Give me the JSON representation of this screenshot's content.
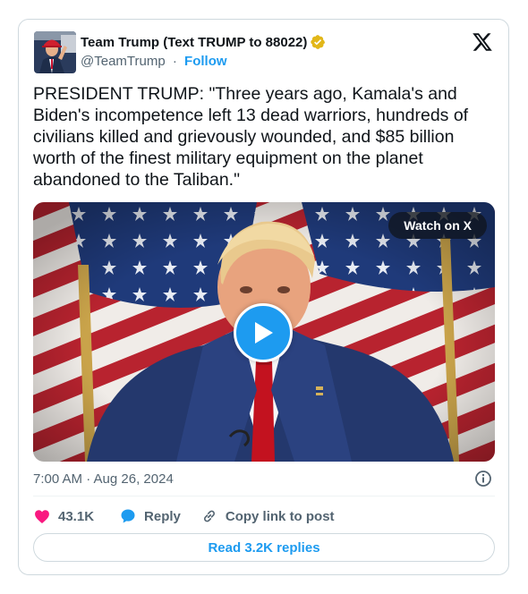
{
  "author": {
    "name": "Team Trump (Text TRUMP to 88022)",
    "handle": "@TeamTrump",
    "separator": "·",
    "follow_label": "Follow",
    "verified_color": "#e2b719"
  },
  "tweet": {
    "text": "PRESIDENT TRUMP: \"Three years ago, Kamala's and Biden's incompetence left 13 dead warriors, hundreds of civilians killed and grievously wounded, and $85 billion worth of the finest military equipment on the planet abandoned to the Taliban.\"",
    "timestamp": "7:00 AM · Aug 26, 2024"
  },
  "media": {
    "watch_label": "Watch on X",
    "play_icon": "play-icon"
  },
  "actions": {
    "likes": "43.1K",
    "reply_label": "Reply",
    "copy_link_label": "Copy link to post",
    "read_replies_label": "Read 3.2K replies"
  },
  "colors": {
    "accent": "#1d9bf0",
    "like": "#f91880",
    "muted": "#536471",
    "border": "#cfd9de"
  },
  "icons": [
    "x-logo-icon",
    "verified-badge-icon",
    "info-icon",
    "heart-icon",
    "reply-bubble-icon",
    "link-icon",
    "play-icon"
  ]
}
